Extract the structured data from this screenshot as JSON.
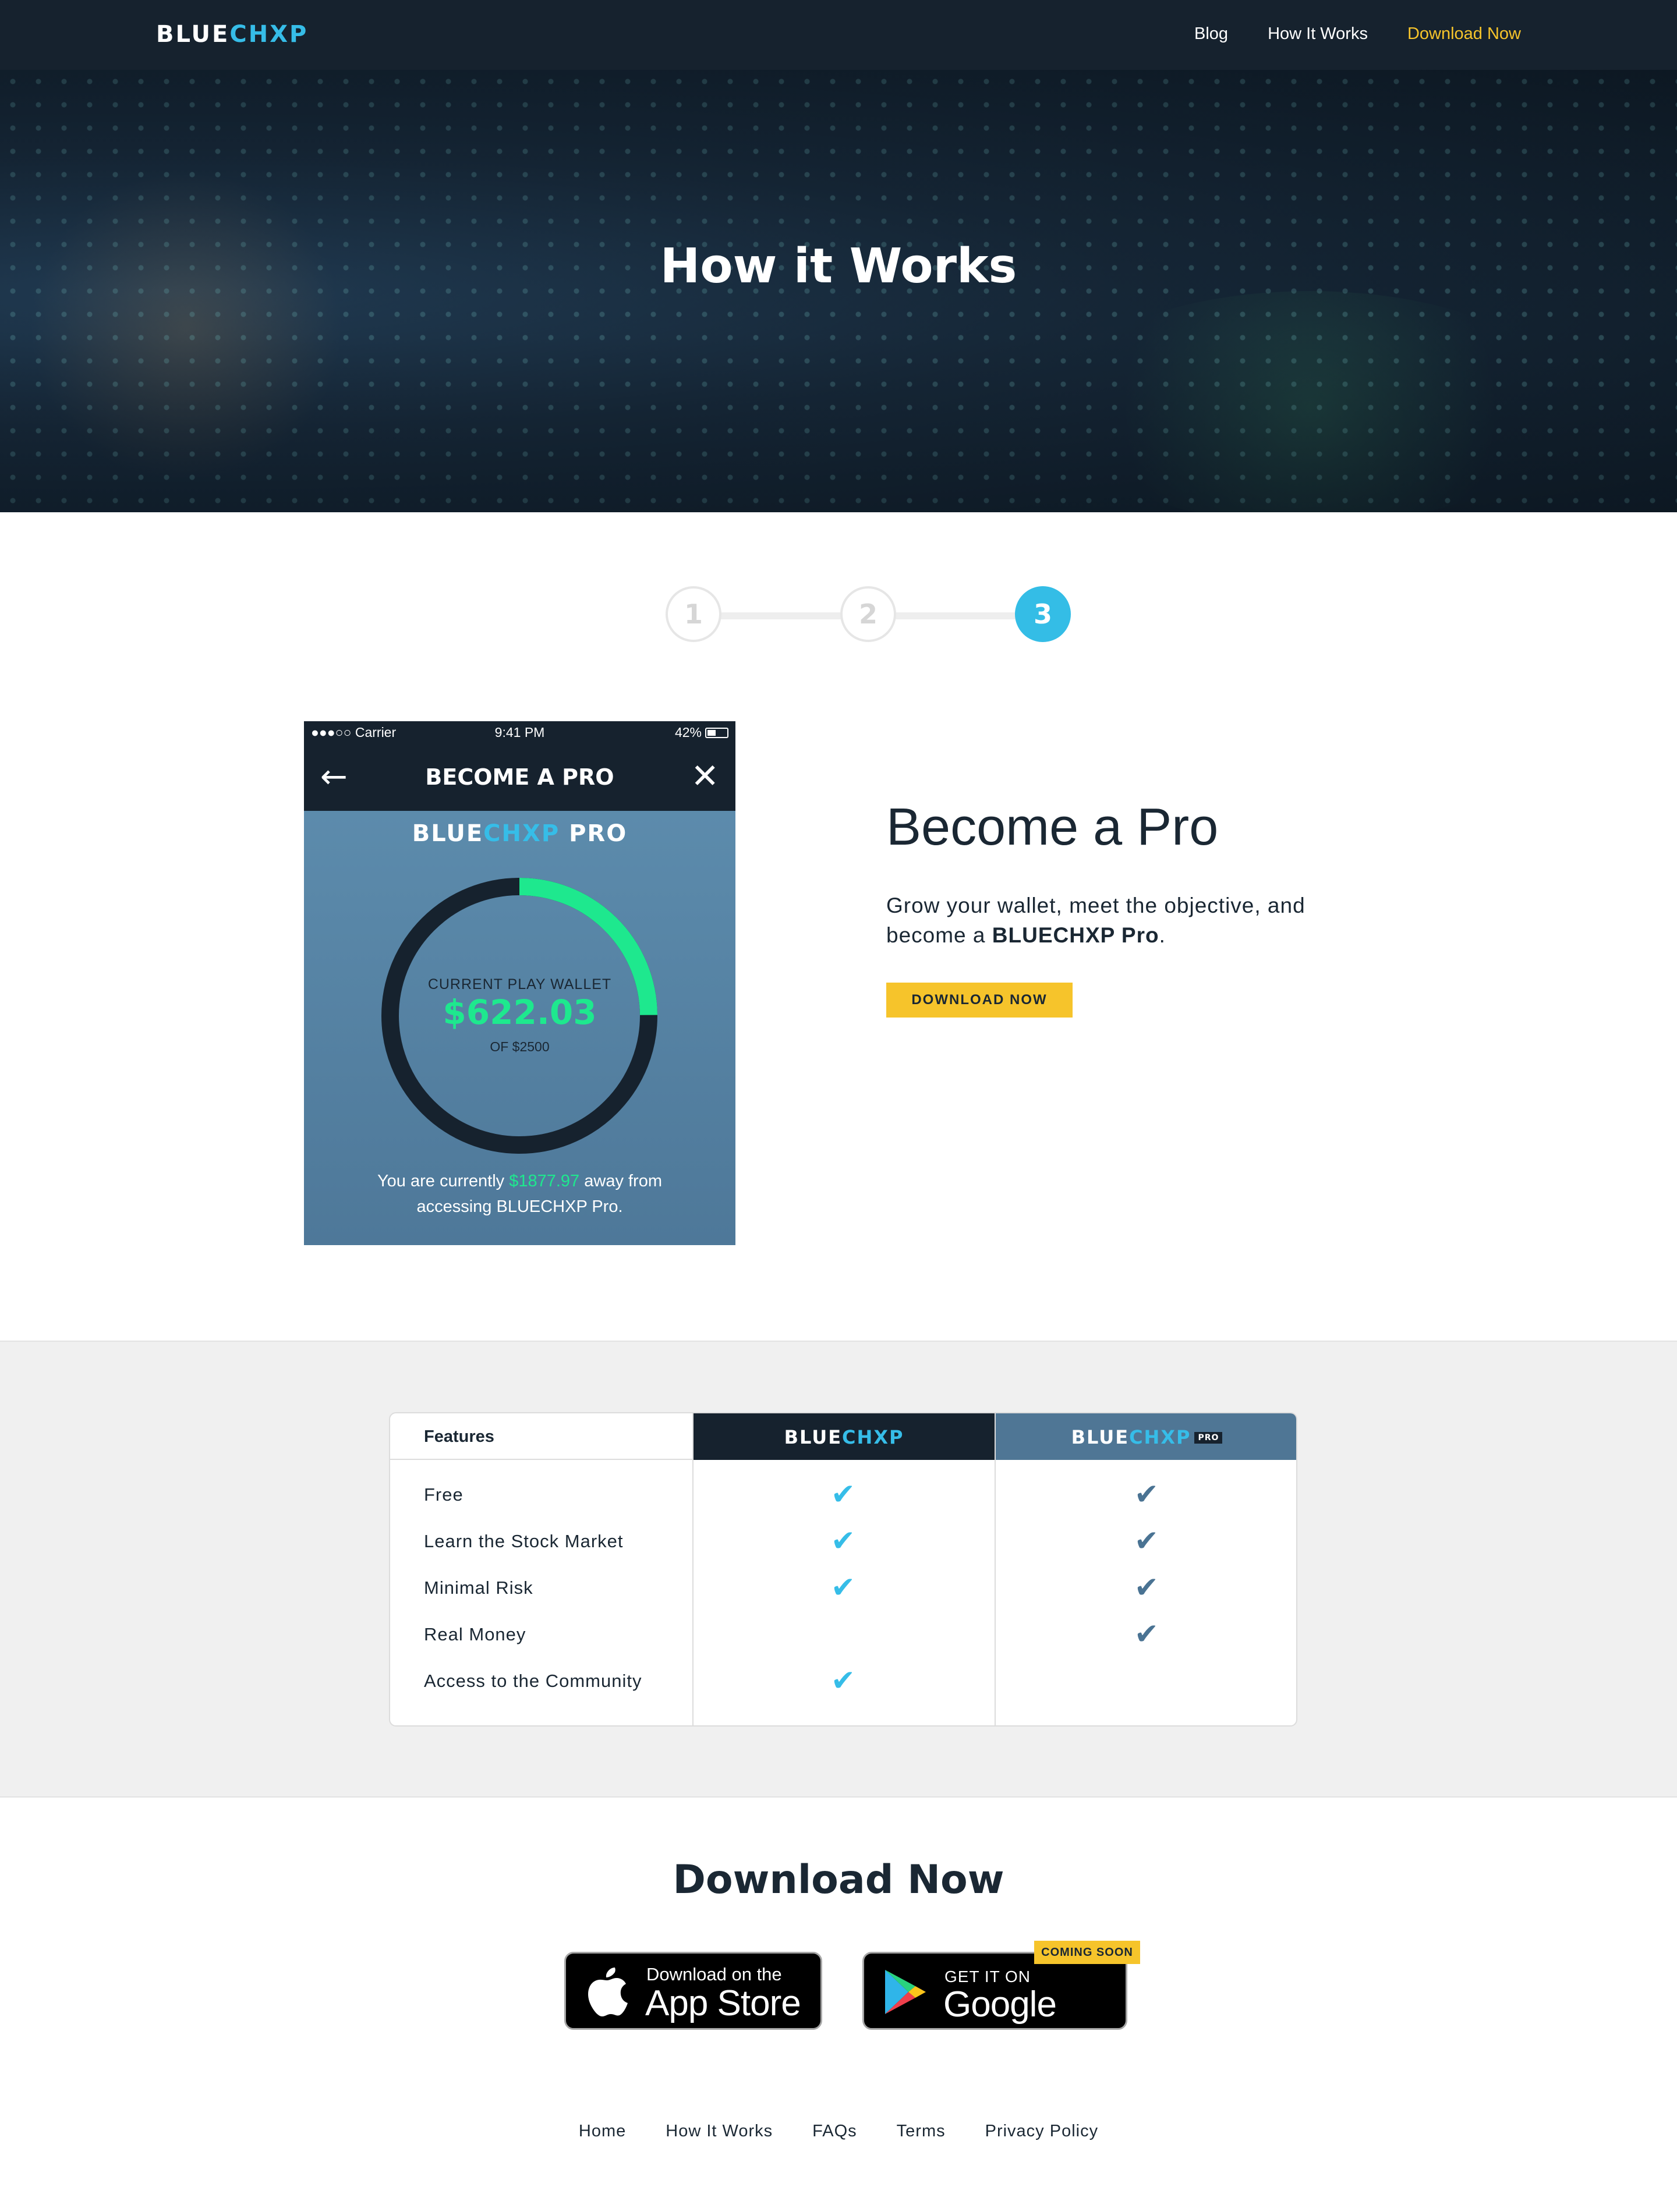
{
  "nav": {
    "logo_part1": "BLUE",
    "logo_part2": "CHXP",
    "links": [
      {
        "label": "Blog"
      },
      {
        "label": "How It Works"
      },
      {
        "label": "Download Now"
      }
    ]
  },
  "hero": {
    "title": "How it Works"
  },
  "steps": {
    "items": [
      "1",
      "2",
      "3"
    ],
    "active_index": 3
  },
  "phone": {
    "status_carrier": "●●●○○ Carrier",
    "status_time": "9:41 PM",
    "status_battery": "42%",
    "appbar_title": "BECOME A PRO",
    "back_icon": "arrow-left-icon",
    "close_icon": "close-icon",
    "pro_logo_part1": "BLUE",
    "pro_logo_part2": "CHXP",
    "pro_logo_suffix": "PRO",
    "wallet_label": "CURRENT PLAY WALLET",
    "wallet_value": "$622.03",
    "wallet_of": "OF $2500",
    "progress_fraction": 0.249,
    "note_prefix": "You are currently ",
    "note_amount": "$1877.97",
    "note_suffix": " away from accessing BLUECHXP Pro.",
    "ring_track_color": "#16222e",
    "ring_progress_color": "#1ee88e"
  },
  "become_pro": {
    "title": "Become a Pro",
    "desc_prefix": "Grow your wallet, meet the objective, and become a ",
    "desc_bold": "BLUECHXP Pro",
    "desc_suffix": ".",
    "button": "DOWNLOAD NOW"
  },
  "features": {
    "header": "Features",
    "col1_logo_part1": "BLUE",
    "col1_logo_part2": "CHXP",
    "col2_logo_part1": "BLUE",
    "col2_logo_part2": "CHXP",
    "col2_tag": "PRO",
    "rows": [
      {
        "name": "Free",
        "basic": true,
        "pro": true
      },
      {
        "name": "Learn the Stock Market",
        "basic": true,
        "pro": true
      },
      {
        "name": "Minimal Risk",
        "basic": true,
        "pro": true
      },
      {
        "name": "Real Money",
        "basic": false,
        "pro": true
      },
      {
        "name": "Access to the Community",
        "basic": true,
        "pro": false
      }
    ],
    "check_icon": "checkmark-icon"
  },
  "download": {
    "title": "Download Now",
    "apple_small": "Download on the",
    "apple_big": "App Store",
    "google_small": "GET IT ON",
    "google_big": "Google Play",
    "coming_soon": "COMING SOON"
  },
  "footer": {
    "links": [
      "Home",
      "How It Works",
      "FAQs",
      "Terms",
      "Privacy Policy"
    ]
  },
  "colors": {
    "accent_blue": "#36bde8",
    "accent_yellow": "#f6c42b",
    "dark_navy": "#16222e",
    "pro_blue": "#4f7695",
    "green": "#1ee88e"
  }
}
